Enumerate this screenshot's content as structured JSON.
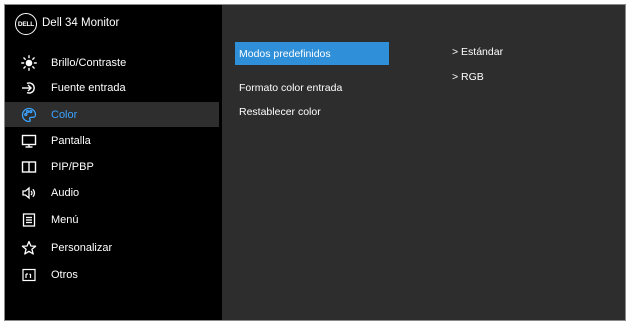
{
  "header": {
    "logo_text": "DELL",
    "title": "Dell 34 Monitor"
  },
  "menu": [
    {
      "label": "Brillo/Contraste",
      "icon": "brightness-icon"
    },
    {
      "label": "Fuente entrada",
      "icon": "input-source-icon"
    },
    {
      "label": "Color",
      "icon": "color-palette-icon",
      "selected": true
    },
    {
      "label": "Pantalla",
      "icon": "display-icon"
    },
    {
      "label": "PIP/PBP",
      "icon": "pip-pbp-icon"
    },
    {
      "label": "Audio",
      "icon": "audio-icon"
    },
    {
      "label": "Menú",
      "icon": "menu-icon"
    },
    {
      "label": "Personalizar",
      "icon": "star-icon"
    },
    {
      "label": "Otros",
      "icon": "others-icon"
    }
  ],
  "submenu": [
    {
      "label": "Modos predefinidos",
      "value": "> Estándar",
      "selected": true
    },
    {
      "label": "Formato color entrada",
      "value": "> RGB"
    },
    {
      "label": "Restablecer color"
    }
  ],
  "colors": {
    "highlight": "#2f8fd8",
    "selected_text": "#3aa3ff",
    "panel": "#2d2d2d",
    "sidebar": "#000000"
  }
}
